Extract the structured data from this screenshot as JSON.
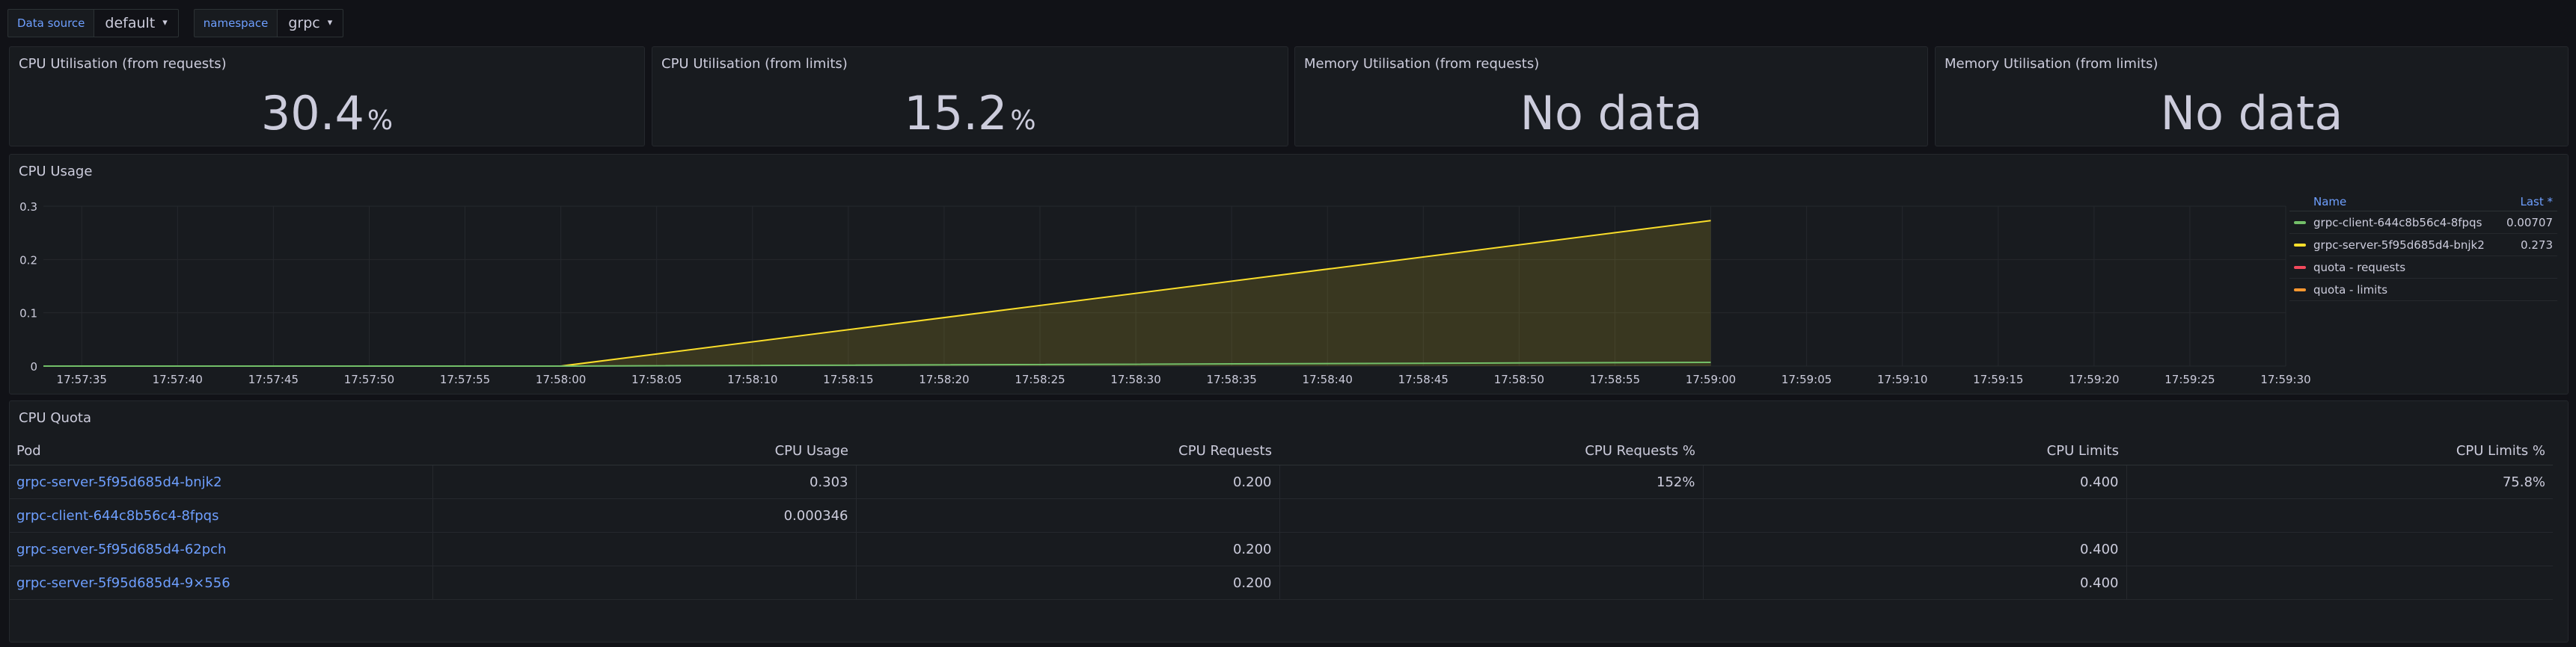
{
  "variables": [
    {
      "label": "Data source",
      "value": "default"
    },
    {
      "label": "namespace",
      "value": "grpc"
    }
  ],
  "stats": [
    {
      "title": "CPU Utilisation (from requests)",
      "value": "30.4",
      "unit": "%"
    },
    {
      "title": "CPU Utilisation (from limits)",
      "value": "15.2",
      "unit": "%"
    },
    {
      "title": "Memory Utilisation (from requests)",
      "value": "No data"
    },
    {
      "title": "Memory Utilisation (from limits)",
      "value": "No data"
    }
  ],
  "cpu_usage_panel": {
    "title": "CPU Usage",
    "legend_header": {
      "name": "Name",
      "last": "Last *"
    },
    "legend": [
      {
        "name": "grpc-client-644c8b56c4-8fpqs",
        "last": "0.00707",
        "color": "#73bf69"
      },
      {
        "name": "grpc-server-5f95d685d4-bnjk2",
        "last": "0.273",
        "color": "#fade2a"
      },
      {
        "name": "quota - requests",
        "last": "",
        "color": "#f2495c"
      },
      {
        "name": "quota - limits",
        "last": "",
        "color": "#ff9830"
      }
    ]
  },
  "chart_data": {
    "type": "line",
    "title": "CPU Usage",
    "x_ticks": [
      "17:57:35",
      "17:57:40",
      "17:57:45",
      "17:57:50",
      "17:57:55",
      "17:58:00",
      "17:58:05",
      "17:58:10",
      "17:58:15",
      "17:58:20",
      "17:58:25",
      "17:58:30",
      "17:58:35",
      "17:58:40",
      "17:58:45",
      "17:58:50",
      "17:58:55",
      "17:59:00",
      "17:59:05",
      "17:59:10",
      "17:59:15",
      "17:59:20",
      "17:59:25",
      "17:59:30"
    ],
    "y_ticks": [
      "0",
      "0.1",
      "0.2",
      "0.3"
    ],
    "ylim": [
      0,
      0.3
    ],
    "xlim": [
      "17:57:33",
      "17:59:30"
    ],
    "series": [
      {
        "name": "grpc-server-5f95d685d4-bnjk2",
        "color": "#fade2a",
        "fill": true,
        "points": [
          [
            "17:57:33",
            0
          ],
          [
            "17:58:00",
            0
          ],
          [
            "17:59:00",
            0.273
          ]
        ]
      },
      {
        "name": "grpc-client-644c8b56c4-8fpqs",
        "color": "#73bf69",
        "fill": false,
        "points": [
          [
            "17:57:33",
            0
          ],
          [
            "17:58:00",
            0
          ],
          [
            "17:59:00",
            0.00707
          ]
        ]
      }
    ],
    "legend": "right"
  },
  "quota_table": {
    "title": "CPU Quota",
    "columns": [
      "Pod",
      "CPU Usage",
      "CPU Requests",
      "CPU Requests %",
      "CPU Limits",
      "CPU Limits %"
    ],
    "rows": [
      [
        "grpc-server-5f95d685d4-bnjk2",
        "0.303",
        "0.200",
        "152%",
        "0.400",
        "75.8%"
      ],
      [
        "grpc-client-644c8b56c4-8fpqs",
        "0.000346",
        "",
        "",
        "",
        ""
      ],
      [
        "grpc-server-5f95d685d4-62pch",
        "",
        "0.200",
        "",
        "0.400",
        ""
      ],
      [
        "grpc-server-5f95d685d4-9×556",
        "",
        "0.200",
        "",
        "0.400",
        ""
      ]
    ]
  },
  "colors": {
    "background": "#111217",
    "panel": "#181b1f",
    "accent": "#6e9fff"
  }
}
